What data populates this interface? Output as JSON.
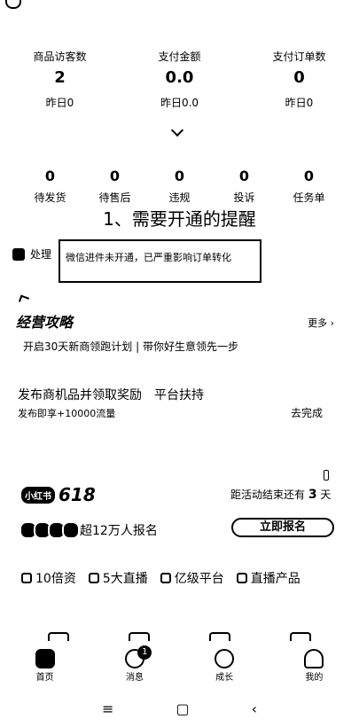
{
  "stats": [
    {
      "label": "商品访客数",
      "value": "2",
      "sub": "昨日0"
    },
    {
      "label": "支付金额",
      "value": "0.0",
      "sub": "昨日0.0"
    },
    {
      "label": "支付订单数",
      "value": "0",
      "sub": "昨日0"
    }
  ],
  "orders": [
    {
      "count": "0",
      "label": "待发货"
    },
    {
      "count": "0",
      "label": "待售后"
    },
    {
      "count": "0",
      "label": "违规"
    },
    {
      "count": "0",
      "label": "投诉"
    },
    {
      "count": "0",
      "label": "任务单"
    }
  ],
  "reminder_title": "1、需要开通的提醒",
  "alert": {
    "handle_label": "处理",
    "message": "微信进件未开通，已严重影响订单转化"
  },
  "guide": {
    "title": "经营攻略",
    "more": "更多 ›",
    "description": "开启30天新商领跑计划 | 带你好生意领先一步"
  },
  "task": {
    "title": "发布商机品并领取奖励　平台扶持",
    "description": "发布即享+10000流量",
    "action": "去完成"
  },
  "promo": {
    "badge": "小红书",
    "event": "618",
    "countdown_prefix": "距活动结束还有",
    "countdown_value": "3",
    "countdown_suffix": "天",
    "signups": "超12万人报名",
    "signup_button": "立即报名"
  },
  "features": [
    "10倍资",
    "5大直播",
    "亿级平台",
    "直播产品"
  ],
  "tabbar": [
    {
      "label": "首页",
      "icon": "home-icon"
    },
    {
      "label": "消息",
      "icon": "message-icon",
      "badge": "1"
    },
    {
      "label": "成长",
      "icon": "growth-icon"
    },
    {
      "label": "我的",
      "icon": "profile-icon"
    }
  ],
  "system_nav": {
    "menu": "≡",
    "home": "▢",
    "back": "‹"
  }
}
